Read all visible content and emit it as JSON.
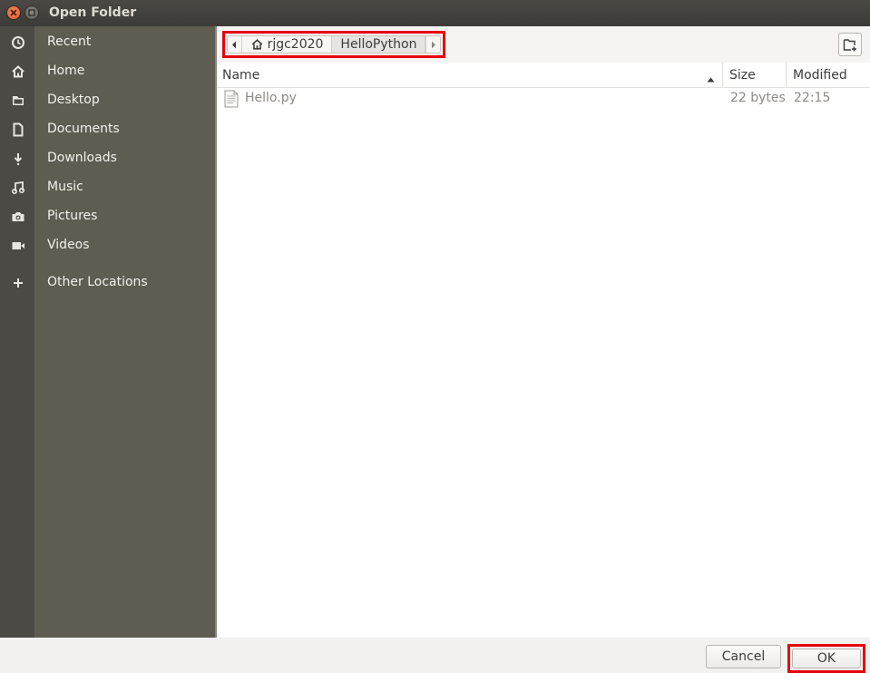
{
  "window": {
    "title": "Open Folder"
  },
  "sidebar": {
    "items": [
      {
        "label": "Recent",
        "icon": "clock-icon"
      },
      {
        "label": "Home",
        "icon": "home-icon"
      },
      {
        "label": "Desktop",
        "icon": "folder-icon"
      },
      {
        "label": "Documents",
        "icon": "document-icon"
      },
      {
        "label": "Downloads",
        "icon": "download-icon"
      },
      {
        "label": "Music",
        "icon": "music-icon"
      },
      {
        "label": "Pictures",
        "icon": "camera-icon"
      },
      {
        "label": "Videos",
        "icon": "video-icon"
      },
      {
        "label": "Other Locations",
        "icon": "plus-icon"
      }
    ]
  },
  "pathbar": {
    "segments": [
      {
        "label": "rjgc2020",
        "icon": "home-icon"
      },
      {
        "label": "HelloPython",
        "active": true
      }
    ]
  },
  "columns": {
    "name": "Name",
    "size": "Size",
    "modified": "Modified"
  },
  "files": [
    {
      "name": "Hello.py",
      "size": "22 bytes",
      "modified": "22:15",
      "icon": "text-file-icon"
    }
  ],
  "buttons": {
    "cancel": "Cancel",
    "ok": "OK"
  },
  "colors": {
    "highlight": "#e8000b",
    "sidebar": "#5f5c51",
    "titlebar": "#3c3b37"
  }
}
